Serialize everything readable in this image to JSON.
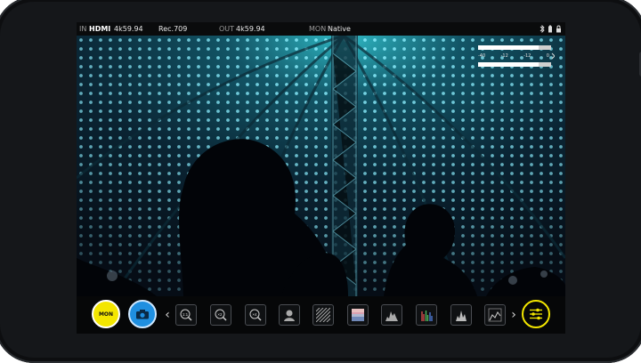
{
  "status": {
    "in_label": "IN",
    "in_source": "HDMI",
    "in_format": "4k59.94",
    "color_space": "Rec.709",
    "out_label": "OUT",
    "out_format": "4k59.94",
    "mon_label": "MON",
    "mon_mode": "Native"
  },
  "audio_meter": {
    "scale": [
      "-40",
      "-12",
      "-12",
      "0"
    ],
    "level_fraction": 0.83
  },
  "toolbar": {
    "mon_button_label": "MON",
    "buttons": [
      "zoom-1-1",
      "zoom-2x",
      "zoom-4x",
      "focus-peaking",
      "zebra",
      "false-color",
      "waveform",
      "rgb-parade",
      "vectorscope",
      "scope-settings"
    ],
    "zoom_labels": [
      "1:1",
      "×2",
      "×4"
    ]
  },
  "colors": {
    "accent_yellow": "#f3e600",
    "accent_blue": "#1f8fe0",
    "led_cyan": "#6fe6ff"
  }
}
